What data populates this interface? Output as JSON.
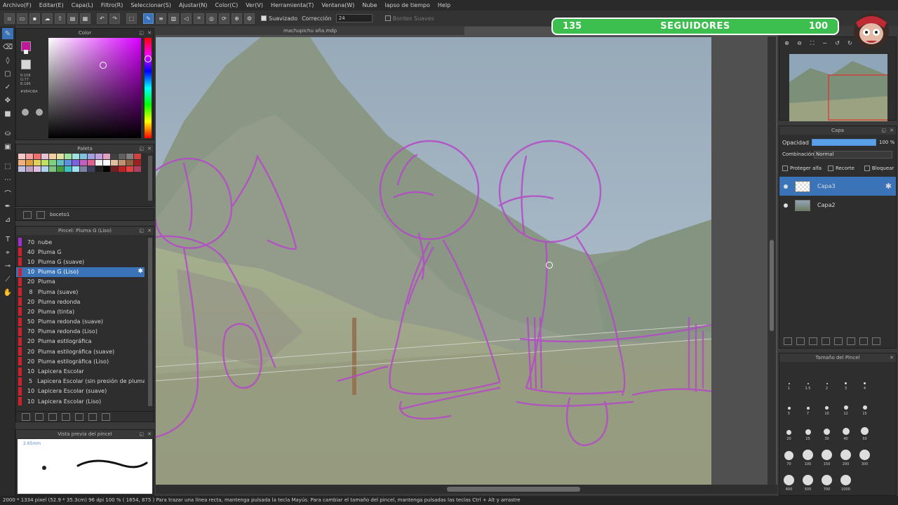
{
  "menu": [
    "Archivo(F)",
    "Editar(E)",
    "Capa(L)",
    "Filtro(R)",
    "Seleccionar(S)",
    "Ajustar(N)",
    "Color(C)",
    "Ver(V)",
    "Herramienta(T)",
    "Ventana(W)",
    "Nube",
    "lapso de tiempo",
    "Help"
  ],
  "toolbar": {
    "smooth_label": "Suavizado",
    "correction_label": "Corrección",
    "correction_value": "24",
    "soft_edges_label": "Bordes Suaves"
  },
  "color_panel": {
    "title": "Color",
    "rgb": [
      "R:158",
      "G:77",
      "B:186"
    ],
    "hex": "#9B4DBA",
    "main_color": "#c0189a"
  },
  "palette_panel": {
    "title": "Paleta"
  },
  "sketch_layer_label": "boceto1",
  "brush_panel": {
    "title": "Pincel: Pluma G (Liso)",
    "items": [
      {
        "size": "70",
        "name": "nube",
        "color": "#a12fd0"
      },
      {
        "size": "40",
        "name": "Pluma G",
        "color": "#d02030"
      },
      {
        "size": "10",
        "name": "Pluma G (suave)",
        "color": "#d02030"
      },
      {
        "size": "10",
        "name": "Pluma G (Liso)",
        "color": "#d02030",
        "selected": true
      },
      {
        "size": "20",
        "name": "Pluma",
        "color": "#d02030"
      },
      {
        "size": "8",
        "name": "Pluma (suave)",
        "color": "#d02030"
      },
      {
        "size": "20",
        "name": "Pluma redonda",
        "color": "#d02030"
      },
      {
        "size": "20",
        "name": "Pluma (tinta)",
        "color": "#d02030"
      },
      {
        "size": "50",
        "name": "Pluma redonda (suave)",
        "color": "#d02030"
      },
      {
        "size": "70",
        "name": "Pluma redonda (Liso)",
        "color": "#d02030"
      },
      {
        "size": "20",
        "name": "Pluma estilográfica",
        "color": "#d02030"
      },
      {
        "size": "20",
        "name": "Pluma estilográfica (suave)",
        "color": "#d02030"
      },
      {
        "size": "20",
        "name": "Pluma estilográfica (Liso)",
        "color": "#d02030"
      },
      {
        "size": "10",
        "name": "Lapicera Escolar",
        "color": "#d02030"
      },
      {
        "size": "5",
        "name": "Lapicera Escolar (sin presión de pluma)",
        "color": "#d02030"
      },
      {
        "size": "10",
        "name": "Lapicera Escolar (suave)",
        "color": "#d02030"
      },
      {
        "size": "10",
        "name": "Lapicera Escolar (Liso)",
        "color": "#d02030"
      }
    ]
  },
  "preview_panel": {
    "title": "Vista previa del pincel",
    "size_label": "2.65mm"
  },
  "document": {
    "tab": "machupichu aña.mdp"
  },
  "followers": {
    "left": "135",
    "label": "SEGUIDORES",
    "right": "100"
  },
  "layer_panel": {
    "title": "Capa",
    "opacity_label": "Opacidad",
    "opacity_value": "100 %",
    "blend_label": "Combinación",
    "blend_value": "Normal",
    "protect_alpha": "Proteger alfa",
    "clip": "Recorte",
    "lock": "Bloquear",
    "layers": [
      {
        "name": "Capa3",
        "selected": true
      },
      {
        "name": "Capa2",
        "selected": false
      }
    ]
  },
  "brush_size_panel": {
    "title": "Tamaño del Pincel",
    "sizes": [
      "1",
      "1.5",
      "2",
      "3",
      "4",
      "5",
      "7",
      "10",
      "12",
      "15",
      "20",
      "25",
      "30",
      "40",
      "50",
      "70",
      "100",
      "150",
      "200",
      "300",
      "400",
      "500",
      "700",
      "1000"
    ]
  },
  "status_text": "2000 * 1334 pixel  (52.9 * 35.3cm)  96 dpi  100 %  ( 1654, 875 )   Para trazar una línea recta, mantenga pulsada la tecla Mayús. Para cambiar el tamaño del pincel, mantenga pulsadas las teclas Ctrl + Alt y arrastre"
}
